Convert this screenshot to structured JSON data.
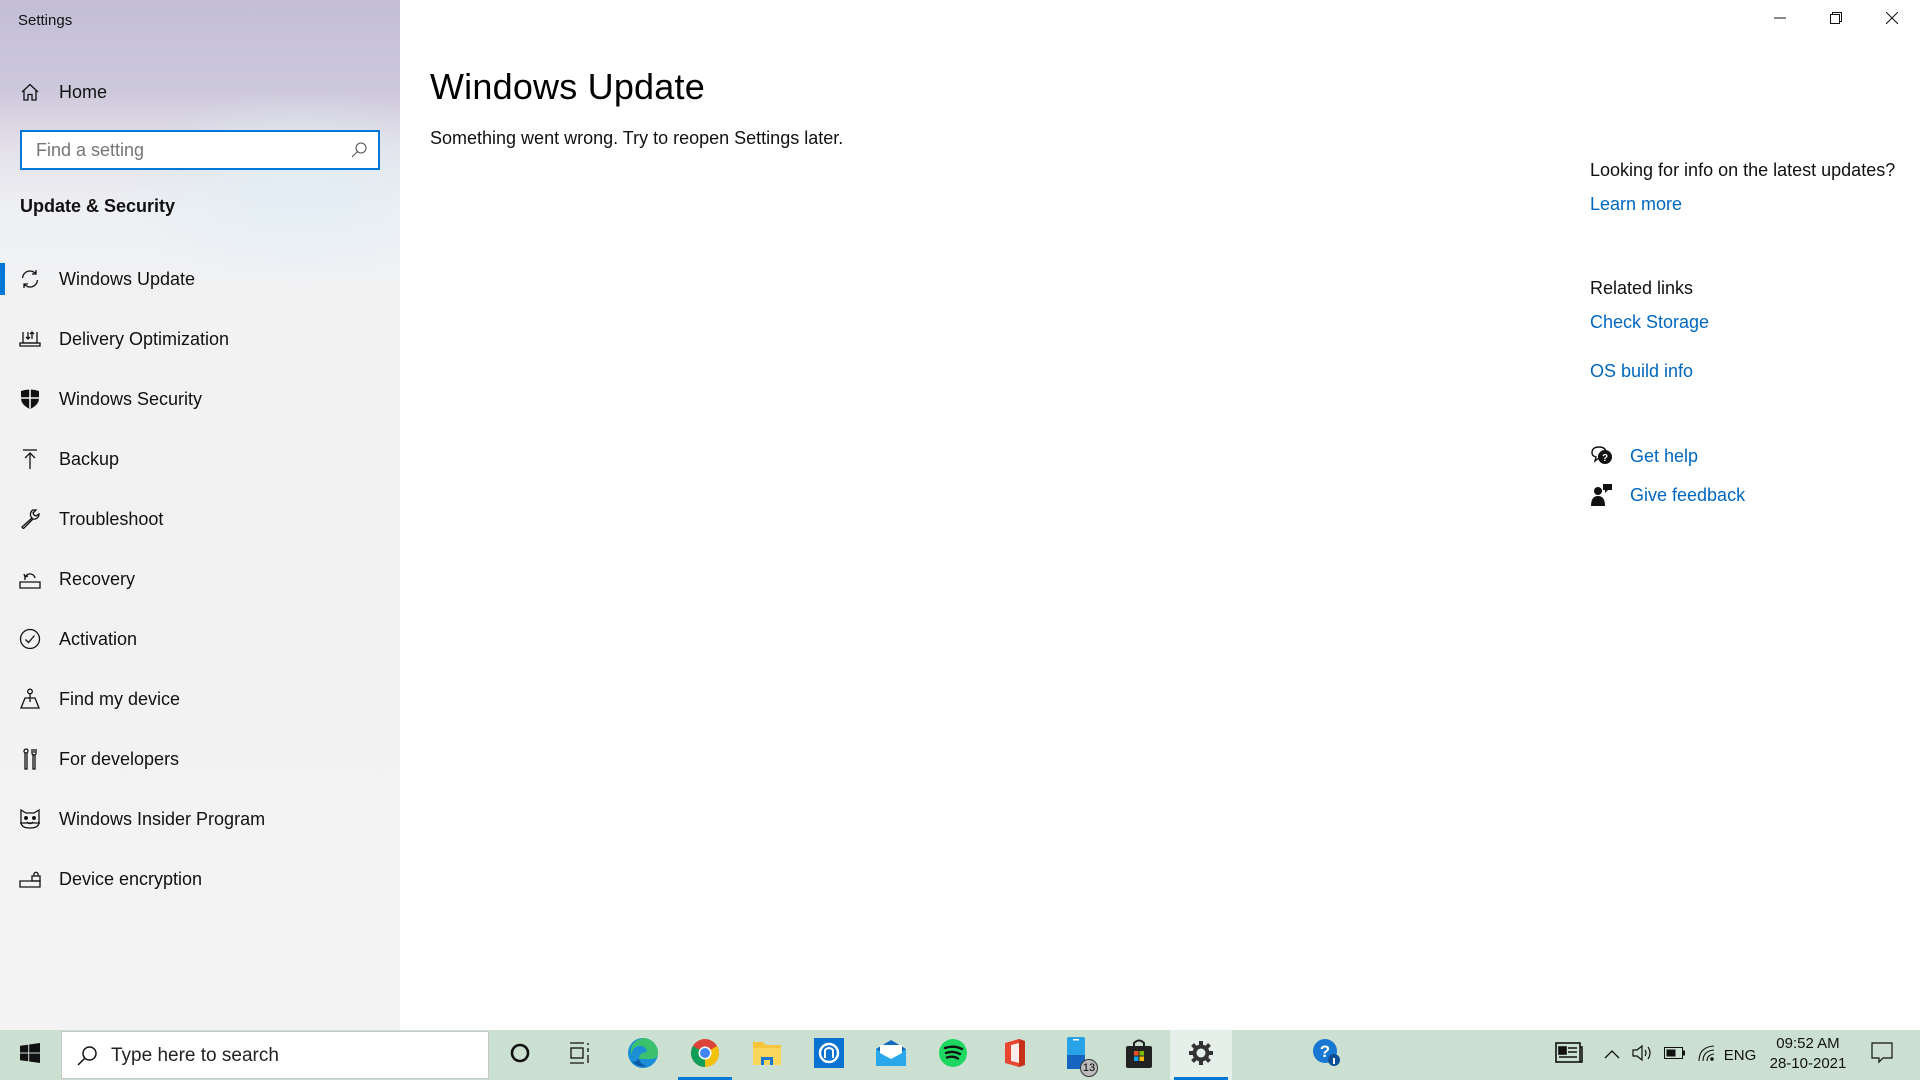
{
  "window": {
    "app_title": "Settings",
    "controls": {
      "minimize": "minimize-icon",
      "restore": "restore-icon",
      "close": "close-icon"
    }
  },
  "sidebar": {
    "home_label": "Home",
    "search": {
      "placeholder": "Find a setting",
      "value": ""
    },
    "section_title": "Update & Security",
    "items": [
      {
        "label": "Windows Update",
        "icon": "sync-icon",
        "active": true
      },
      {
        "label": "Delivery Optimization",
        "icon": "delivery-optimization-icon",
        "active": false
      },
      {
        "label": "Windows Security",
        "icon": "shield-icon",
        "active": false
      },
      {
        "label": "Backup",
        "icon": "backup-arrow-icon",
        "active": false
      },
      {
        "label": "Troubleshoot",
        "icon": "wrench-icon",
        "active": false
      },
      {
        "label": "Recovery",
        "icon": "recovery-icon",
        "active": false
      },
      {
        "label": "Activation",
        "icon": "check-circle-icon",
        "active": false
      },
      {
        "label": "Find my device",
        "icon": "find-device-icon",
        "active": false
      },
      {
        "label": "For developers",
        "icon": "developer-tools-icon",
        "active": false
      },
      {
        "label": "Windows Insider Program",
        "icon": "insider-cat-icon",
        "active": false
      },
      {
        "label": "Device encryption",
        "icon": "encryption-lock-icon",
        "active": false
      }
    ]
  },
  "main": {
    "title": "Windows Update",
    "error_message": "Something went wrong. Try to reopen Settings later."
  },
  "right_panel": {
    "info_question": "Looking for info on the latest updates?",
    "learn_more": "Learn more",
    "related_links_heading": "Related links",
    "related_links": [
      "Check Storage",
      "OS build info"
    ],
    "get_help": "Get help",
    "give_feedback": "Give feedback"
  },
  "taskbar": {
    "search_placeholder": "Type here to search",
    "apps": [
      {
        "name": "cortana",
        "icon": "cortana-circle-icon",
        "running": false
      },
      {
        "name": "task-view",
        "icon": "task-view-icon",
        "running": false
      },
      {
        "name": "edge",
        "icon": "edge-icon",
        "running": false
      },
      {
        "name": "chrome",
        "icon": "chrome-icon",
        "running": true
      },
      {
        "name": "file-explorer",
        "icon": "folder-icon",
        "running": false
      },
      {
        "name": "app-blue",
        "icon": "blue-app-icon",
        "running": false
      },
      {
        "name": "mail",
        "icon": "mail-icon",
        "running": false
      },
      {
        "name": "spotify",
        "icon": "spotify-icon",
        "running": false
      },
      {
        "name": "office",
        "icon": "office-icon",
        "running": false
      },
      {
        "name": "your-phone",
        "icon": "phone-icon",
        "running": false,
        "badge": "13"
      },
      {
        "name": "store",
        "icon": "store-icon",
        "running": false
      },
      {
        "name": "settings",
        "icon": "gear-icon",
        "running": true,
        "focused": true
      },
      {
        "name": "get-help",
        "icon": "help-app-icon",
        "running": false
      }
    ],
    "tray": {
      "language": "ENG",
      "time": "09:52 AM",
      "date": "28-10-2021"
    }
  },
  "colors": {
    "accent": "#0078d7",
    "link": "#0067c0",
    "taskbar_bg": "#cce0d2"
  }
}
